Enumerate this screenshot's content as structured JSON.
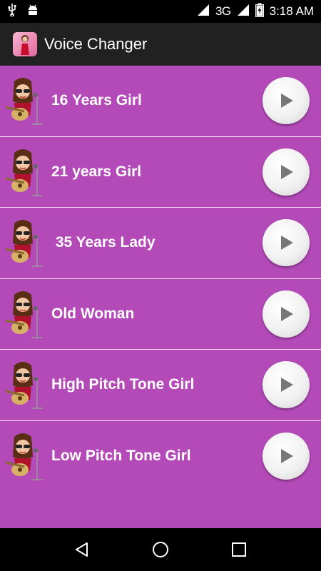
{
  "status_bar": {
    "network": "3G",
    "time": "3:18 AM"
  },
  "app_bar": {
    "title": "Voice Changer"
  },
  "voices": [
    {
      "label": "16 Years Girl"
    },
    {
      "label": "21 years Girl"
    },
    {
      "label": " 35 Years Lady"
    },
    {
      "label": "Old Woman"
    },
    {
      "label": "High Pitch Tone Girl"
    },
    {
      "label": "Low Pitch Tone Girl"
    }
  ],
  "colors": {
    "list_background": "#b34ab8",
    "app_bar": "#212121",
    "divider": "#f3e3f4"
  },
  "icons": {
    "avatar": "girl-singer-icon",
    "play": "play-icon",
    "nav_back": "back-icon",
    "nav_home": "home-icon",
    "nav_recents": "recents-icon"
  }
}
